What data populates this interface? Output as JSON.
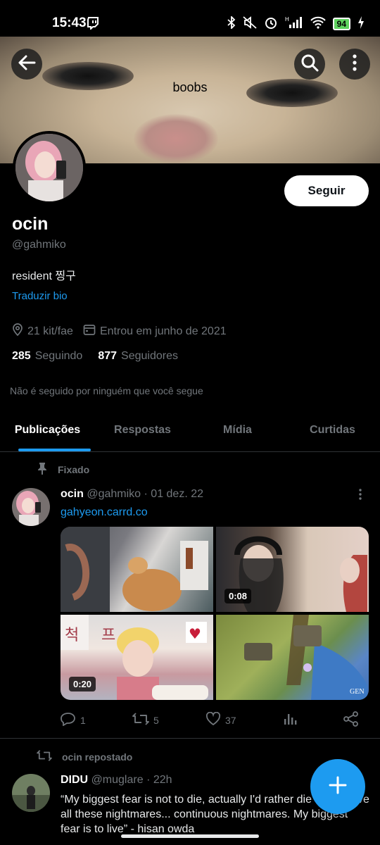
{
  "status_bar": {
    "time": "15:43",
    "battery": "94",
    "icons": [
      "twitch-icon",
      "bluetooth-icon",
      "mute-icon",
      "alarm-icon",
      "signal-icon",
      "wifi-icon",
      "charging-icon"
    ]
  },
  "banner": {
    "caption": "boobs"
  },
  "profile": {
    "name": "ocin",
    "handle": "@gahmiko",
    "bio": "resident 찡구",
    "translate_label": "Traduzir bio",
    "location": "21 kit/fae",
    "joined": "Entrou em junho de 2021",
    "following_count": "285",
    "following_label": "Seguindo",
    "followers_count": "877",
    "followers_label": "Seguidores",
    "followed_by_note": "Não é seguido por ninguém que você segue",
    "follow_button": "Seguir"
  },
  "tabs": [
    {
      "label": "Publicações",
      "active": true
    },
    {
      "label": "Respostas",
      "active": false
    },
    {
      "label": "Mídia",
      "active": false
    },
    {
      "label": "Curtidas",
      "active": false
    }
  ],
  "pinned_tweet": {
    "pinned_label": "Fixado",
    "author_name": "ocin",
    "author_handle": "@gahmiko",
    "date": "· 01 dez. 22",
    "link": "gahyeon.carrd.co",
    "media": [
      {
        "type": "image",
        "duration": ""
      },
      {
        "type": "video",
        "duration": "0:08"
      },
      {
        "type": "video",
        "duration": "0:20"
      },
      {
        "type": "image",
        "duration": ""
      }
    ],
    "actions": {
      "replies": "1",
      "reposts": "5",
      "likes": "37"
    }
  },
  "second_tweet": {
    "repost_label": "ocin repostado",
    "author_name": "DIDU",
    "author_handle": "@muglare",
    "time": "· 22h",
    "text": "“My biggest fear is not to die, actually I'd rather die than to live all these nightmares... continuous nightmares. My biggest fear is to live” - hisan owda"
  },
  "colors": {
    "accent": "#1d9bf0",
    "background": "#000000",
    "muted": "#71767b"
  }
}
